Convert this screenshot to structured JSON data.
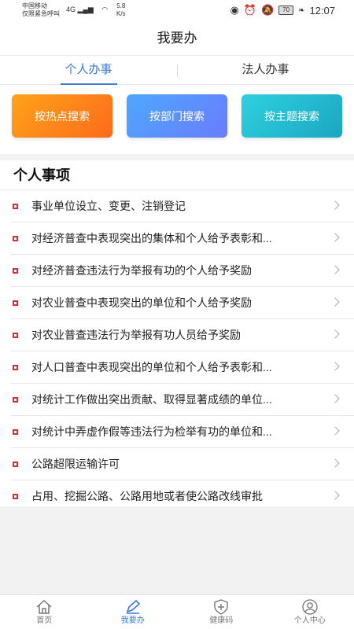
{
  "status_bar": {
    "carrier_line1": "中国移动",
    "carrier_line2": "仅限紧急呼叫",
    "signal": "4G",
    "speed_value": "5.8",
    "speed_unit": "K/s",
    "battery": "70",
    "time": "12:07"
  },
  "header": {
    "title": "我要办"
  },
  "tabs": [
    {
      "label": "个人办事",
      "active": true
    },
    {
      "label": "法人办事",
      "active": false
    }
  ],
  "search_buttons": {
    "hot": "按热点搜索",
    "dept": "按部门搜索",
    "topic": "按主题搜索"
  },
  "section": {
    "title": "个人事项",
    "items": [
      "事业单位设立、变更、注销登记",
      "对经济普查中表现突出的集体和个人给予表彰和...",
      "对经济普查违法行为举报有功的个人给予奖励",
      "对农业普查中表现突出的单位和个人给予奖励",
      "对农业普查违法行为举报有功人员给予奖励",
      "对人口普查中表现突出的单位和个人给予表彰和...",
      "对统计工作做出突出贡献、取得显著成绩的单位...",
      "对统计中弄虚作假等违法行为检举有功的单位和...",
      "公路超限运输许可",
      "占用、挖掘公路、公路用地或者使公路改线审批"
    ]
  },
  "bottom_nav": [
    {
      "label": "首页",
      "icon": "home-icon",
      "active": false
    },
    {
      "label": "我要办",
      "icon": "pen-icon",
      "active": true
    },
    {
      "label": "健康码",
      "icon": "shield-plus-icon",
      "active": false
    },
    {
      "label": "个人中心",
      "icon": "user-icon",
      "active": false
    }
  ],
  "colors": {
    "accent": "#3a7bd5",
    "bullet": "#d9303a"
  }
}
